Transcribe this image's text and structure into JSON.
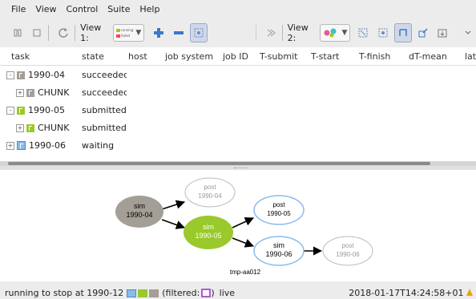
{
  "menu": {
    "items": [
      "File",
      "View",
      "Control",
      "Suite",
      "Help"
    ]
  },
  "toolbar": {
    "view1_label": "View 1:",
    "view2_label": "View 2:",
    "legend": [
      "running",
      "failed"
    ],
    "colors": {
      "running": "#99c92a",
      "failed": "#ff4444",
      "accent": "#3a79c9"
    }
  },
  "tree": {
    "columns": [
      "task",
      "state",
      "host",
      "job system",
      "job ID",
      "T-submit",
      "T-start",
      "T-finish",
      "dT-mean",
      "late"
    ],
    "rows": [
      {
        "name": "1990-04",
        "state": "succeeded",
        "expander": "-",
        "color": "grey",
        "indent": 0
      },
      {
        "name": "CHUNK",
        "state": "succeeded",
        "expander": "+",
        "color": "grey",
        "indent": 1
      },
      {
        "name": "1990-05",
        "state": "submitted",
        "expander": "-",
        "color": "green",
        "indent": 0
      },
      {
        "name": "CHUNK",
        "state": "submitted",
        "expander": "+",
        "color": "green",
        "indent": 1
      },
      {
        "name": "1990-06",
        "state": "waiting",
        "expander": "+",
        "color": "blue",
        "indent": 0
      }
    ]
  },
  "graph": {
    "suite_name": "tmp-aa012",
    "nodes": [
      {
        "id": "sim-1990-04",
        "line1": "sim",
        "line2": "1990-04",
        "style": "succeeded"
      },
      {
        "id": "post-1990-04",
        "line1": "post",
        "line2": "1990-04",
        "style": "waiting-faded"
      },
      {
        "id": "sim-1990-05",
        "line1": "sim",
        "line2": "1990-05",
        "style": "submitted"
      },
      {
        "id": "post-1990-05",
        "line1": "post",
        "line2": "1990-05",
        "style": "waiting"
      },
      {
        "id": "sim-1990-06",
        "line1": "sim",
        "line2": "1990-06",
        "style": "waiting"
      },
      {
        "id": "post-1990-06",
        "line1": "post",
        "line2": "1990-06",
        "style": "waiting-faded"
      }
    ],
    "colors": {
      "succeeded": "#a39e96",
      "submitted": "#99c92a",
      "waiting": "#88bbee"
    }
  },
  "status": {
    "message": "running to stop at 1990-12",
    "filtered_label": "(filtered:",
    "filtered_close": ")",
    "mode": "live",
    "timestamp": "2018-01-17T14:24:58+01"
  }
}
